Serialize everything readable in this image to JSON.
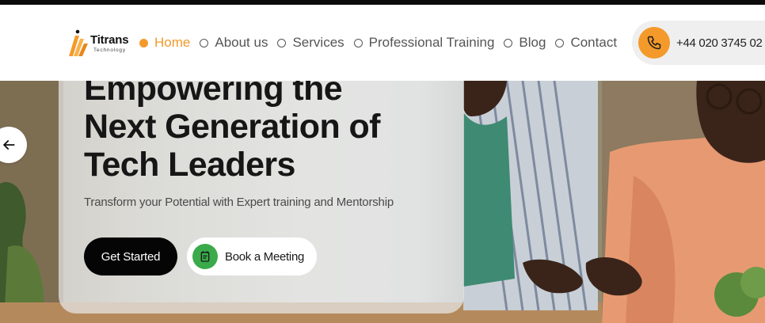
{
  "brand": {
    "name": "Titrans",
    "tagline": "Technology",
    "accent_color": "#f39a2b",
    "logo_icon": "titrans-logo-mark"
  },
  "nav": {
    "items": [
      {
        "label": "Home",
        "active": true
      },
      {
        "label": "About us",
        "active": false
      },
      {
        "label": "Services",
        "active": false
      },
      {
        "label": "Professional Training",
        "active": false
      },
      {
        "label": "Blog",
        "active": false
      },
      {
        "label": "Contact",
        "active": false
      }
    ],
    "phone": {
      "icon": "phone-icon",
      "number": "+44 020 3745 02"
    }
  },
  "hero": {
    "title_lines": [
      "Empowering the",
      "Next Generation of",
      "Tech Leaders"
    ],
    "subtitle": "Transform your Potential with Expert training and Mentorship",
    "primary_button": "Get Started",
    "secondary_button": {
      "label": "Book a Meeting",
      "icon": "calendar-icon",
      "icon_color": "#3aaa4a"
    },
    "prev_arrow_icon": "arrow-left-icon"
  }
}
